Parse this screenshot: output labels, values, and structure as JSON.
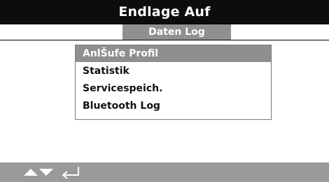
{
  "header": {
    "title": "Endlage Auf"
  },
  "tabs": {
    "active_label": "Daten Log"
  },
  "menu": {
    "items": [
      {
        "label": "AnlŠufe Profil",
        "selected": true
      },
      {
        "label": "Statistik",
        "selected": false
      },
      {
        "label": "Servicespeich.",
        "selected": false
      },
      {
        "label": "Bluetooth Log",
        "selected": false
      }
    ]
  },
  "footer": {
    "icons": [
      "arrow-up-icon",
      "arrow-down-icon",
      "enter-return-icon"
    ]
  },
  "colors": {
    "header_bg": "#0d0d0d",
    "tab_active_bg": "#909090",
    "selection_bg": "#8f8f8f",
    "footer_bg": "#9a9a9a"
  }
}
